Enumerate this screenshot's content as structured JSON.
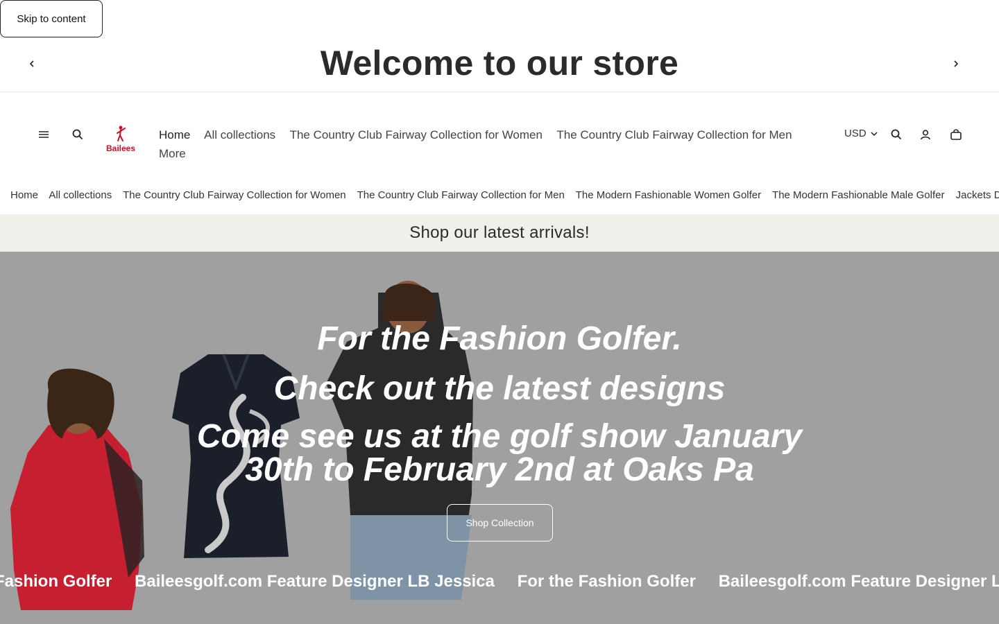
{
  "skip_link": "Skip to content",
  "announcement": {
    "text": "Welcome to our store"
  },
  "brand": {
    "logo_text": "Bailees",
    "logo_color": "#c8102e"
  },
  "main_nav": {
    "items": [
      "Home",
      "All collections",
      "The Country Club Fairway Collection for Women",
      "The Country Club Fairway Collection for Men",
      "More"
    ]
  },
  "currency": "USD",
  "sub_nav": {
    "items": [
      "Home",
      "All collections",
      "The Country Club Fairway Collection for Women",
      "The Country Club Fairway Collection for Men",
      "The Modern Fashionable Women Golfer",
      "The Modern Fashionable Male Golfer",
      "Jackets De"
    ]
  },
  "promo_bar": {
    "text": "Shop our latest arrivals!",
    "bg_color": "#eef0ea"
  },
  "hero": {
    "heading_1": "For the Fashion Golfer.",
    "heading_2": "Check out the latest designs",
    "heading_3": "Come see us at the golf show January 30th to February 2nd at Oaks Pa",
    "button_label": "Shop Collection",
    "bg_color": "#a0a0a0"
  },
  "marquee": {
    "items": [
      "Fashion Golfer",
      "Baileesgolf.com Feature Designer LB Jessica",
      "For the Fashion Golfer",
      "Baileesgolf.com Feature Designer LB"
    ]
  },
  "icons": {
    "menu": "hamburger-icon",
    "search": "search-icon",
    "account": "account-icon",
    "cart": "cart-icon",
    "prev": "chevron-left-icon",
    "next": "chevron-right-icon"
  }
}
